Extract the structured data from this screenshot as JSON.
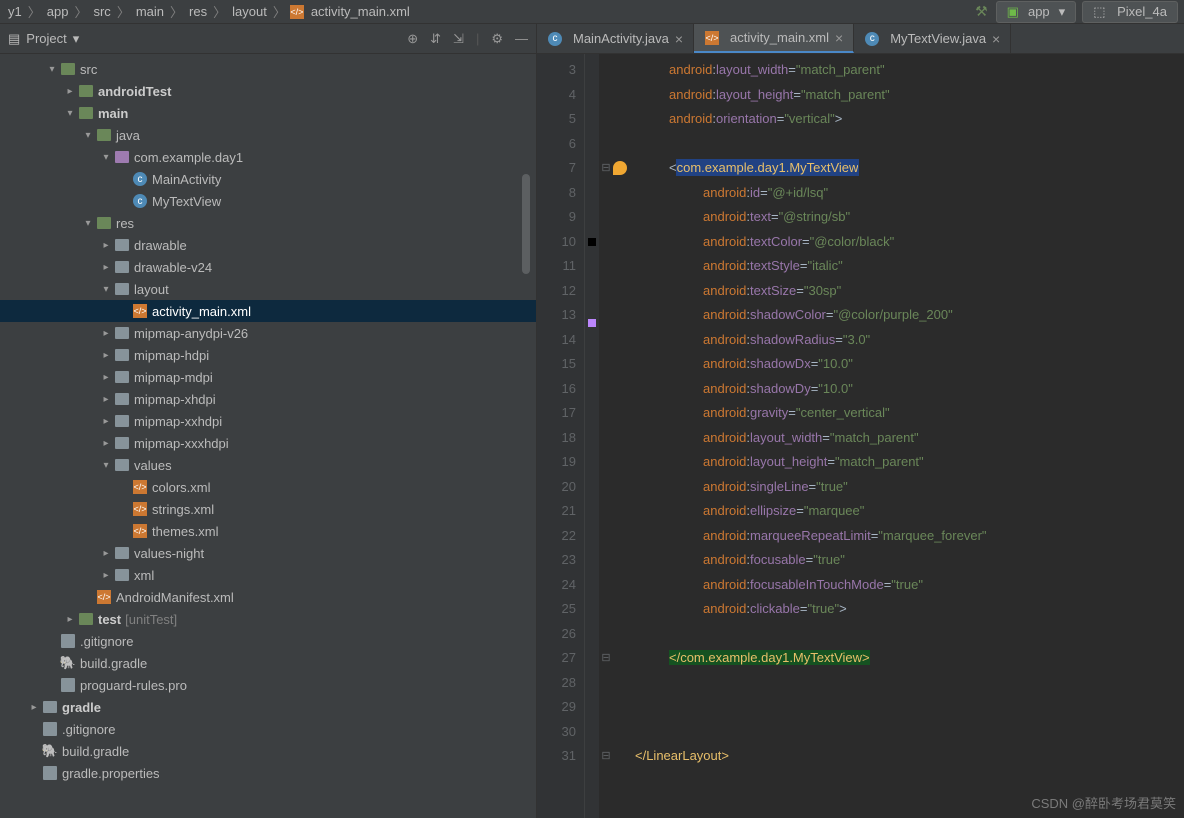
{
  "breadcrumb": {
    "project": "y1",
    "items": [
      "app",
      "src",
      "main",
      "res",
      "layout",
      "activity_main.xml"
    ]
  },
  "runconfig": {
    "label": "app",
    "device": "Pixel_4a"
  },
  "sidebar": {
    "title": "Project",
    "tree": [
      {
        "indent": 2,
        "arrow": "▾",
        "icon": "folder-src",
        "label": "src",
        "bold": false
      },
      {
        "indent": 3,
        "arrow": "▸",
        "icon": "folder-src",
        "label": "androidTest",
        "bold": true
      },
      {
        "indent": 3,
        "arrow": "▾",
        "icon": "folder-src",
        "label": "main",
        "bold": true
      },
      {
        "indent": 4,
        "arrow": "▾",
        "icon": "folder-src",
        "label": "java",
        "bold": false
      },
      {
        "indent": 5,
        "arrow": "▾",
        "icon": "pkg",
        "label": "com.example.day1",
        "bold": false
      },
      {
        "indent": 6,
        "arrow": "",
        "icon": "class",
        "label": "MainActivity",
        "bold": false
      },
      {
        "indent": 6,
        "arrow": "",
        "icon": "class",
        "label": "MyTextView",
        "bold": false
      },
      {
        "indent": 4,
        "arrow": "▾",
        "icon": "folder-src",
        "label": "res",
        "bold": false
      },
      {
        "indent": 5,
        "arrow": "▸",
        "icon": "folder",
        "label": "drawable",
        "bold": false
      },
      {
        "indent": 5,
        "arrow": "▸",
        "icon": "folder",
        "label": "drawable-v24",
        "bold": false
      },
      {
        "indent": 5,
        "arrow": "▾",
        "icon": "folder",
        "label": "layout",
        "bold": false
      },
      {
        "indent": 6,
        "arrow": "",
        "icon": "xml",
        "label": "activity_main.xml",
        "bold": false,
        "selected": true
      },
      {
        "indent": 5,
        "arrow": "▸",
        "icon": "folder",
        "label": "mipmap-anydpi-v26",
        "bold": false
      },
      {
        "indent": 5,
        "arrow": "▸",
        "icon": "folder",
        "label": "mipmap-hdpi",
        "bold": false
      },
      {
        "indent": 5,
        "arrow": "▸",
        "icon": "folder",
        "label": "mipmap-mdpi",
        "bold": false
      },
      {
        "indent": 5,
        "arrow": "▸",
        "icon": "folder",
        "label": "mipmap-xhdpi",
        "bold": false
      },
      {
        "indent": 5,
        "arrow": "▸",
        "icon": "folder",
        "label": "mipmap-xxhdpi",
        "bold": false
      },
      {
        "indent": 5,
        "arrow": "▸",
        "icon": "folder",
        "label": "mipmap-xxxhdpi",
        "bold": false
      },
      {
        "indent": 5,
        "arrow": "▾",
        "icon": "folder",
        "label": "values",
        "bold": false
      },
      {
        "indent": 6,
        "arrow": "",
        "icon": "xml",
        "label": "colors.xml",
        "bold": false
      },
      {
        "indent": 6,
        "arrow": "",
        "icon": "xml",
        "label": "strings.xml",
        "bold": false
      },
      {
        "indent": 6,
        "arrow": "",
        "icon": "xml",
        "label": "themes.xml",
        "bold": false
      },
      {
        "indent": 5,
        "arrow": "▸",
        "icon": "folder",
        "label": "values-night",
        "bold": false
      },
      {
        "indent": 5,
        "arrow": "▸",
        "icon": "folder",
        "label": "xml",
        "bold": false
      },
      {
        "indent": 4,
        "arrow": "",
        "icon": "xml",
        "label": "AndroidManifest.xml",
        "bold": false
      },
      {
        "indent": 3,
        "arrow": "▸",
        "icon": "folder-test",
        "label": "test",
        "hint": "[unitTest]",
        "bold": true
      },
      {
        "indent": 2,
        "arrow": "",
        "icon": "file",
        "label": ".gitignore",
        "bold": false
      },
      {
        "indent": 2,
        "arrow": "",
        "icon": "gradle",
        "label": "build.gradle",
        "bold": false
      },
      {
        "indent": 2,
        "arrow": "",
        "icon": "file",
        "label": "proguard-rules.pro",
        "bold": false
      },
      {
        "indent": 1,
        "arrow": "▸",
        "icon": "folder",
        "label": "gradle",
        "bold": true
      },
      {
        "indent": 1,
        "arrow": "",
        "icon": "file",
        "label": ".gitignore",
        "bold": false
      },
      {
        "indent": 1,
        "arrow": "",
        "icon": "gradle",
        "label": "build.gradle",
        "bold": false
      },
      {
        "indent": 1,
        "arrow": "",
        "icon": "file",
        "label": "gradle.properties",
        "bold": false
      }
    ]
  },
  "tabs": [
    {
      "icon": "class",
      "label": "MainActivity.java",
      "active": false
    },
    {
      "icon": "xml",
      "label": "activity_main.xml",
      "active": true
    },
    {
      "icon": "class",
      "label": "MyTextView.java",
      "active": false
    }
  ],
  "code": {
    "start": 3,
    "lines": [
      {
        "n": 3,
        "tokens": [
          [
            "i",
            4
          ],
          [
            "ns",
            "android"
          ],
          [
            "op",
            ":"
          ],
          [
            "attr",
            "layout_width"
          ],
          [
            "op",
            "="
          ],
          [
            "str",
            "\"match_parent\""
          ]
        ]
      },
      {
        "n": 4,
        "tokens": [
          [
            "i",
            4
          ],
          [
            "ns",
            "android"
          ],
          [
            "op",
            ":"
          ],
          [
            "attr",
            "layout_height"
          ],
          [
            "op",
            "="
          ],
          [
            "str",
            "\"match_parent\""
          ]
        ]
      },
      {
        "n": 5,
        "tokens": [
          [
            "i",
            4
          ],
          [
            "ns",
            "android"
          ],
          [
            "op",
            ":"
          ],
          [
            "attr",
            "orientation"
          ],
          [
            "op",
            "="
          ],
          [
            "str",
            "\"vertical\""
          ],
          [
            "op",
            ">"
          ]
        ]
      },
      {
        "n": 6,
        "tokens": []
      },
      {
        "n": 7,
        "bulb": true,
        "fold": "⊟",
        "tokens": [
          [
            "i",
            4
          ],
          [
            "op",
            "<"
          ],
          [
            "tagc",
            "com.example.day1.MyTextView"
          ]
        ]
      },
      {
        "n": 8,
        "tokens": [
          [
            "i",
            8
          ],
          [
            "ns",
            "android"
          ],
          [
            "op",
            ":"
          ],
          [
            "attr",
            "id"
          ],
          [
            "op",
            "="
          ],
          [
            "str",
            "\"@+id/lsq\""
          ]
        ]
      },
      {
        "n": 9,
        "tokens": [
          [
            "i",
            8
          ],
          [
            "ns",
            "android"
          ],
          [
            "op",
            ":"
          ],
          [
            "attr",
            "text"
          ],
          [
            "op",
            "="
          ],
          [
            "str",
            "\"@string/sb\""
          ]
        ]
      },
      {
        "n": 10,
        "marker": "#000",
        "tokens": [
          [
            "i",
            8
          ],
          [
            "ns",
            "android"
          ],
          [
            "op",
            ":"
          ],
          [
            "attr",
            "textColor"
          ],
          [
            "op",
            "="
          ],
          [
            "str",
            "\"@color/black\""
          ]
        ]
      },
      {
        "n": 11,
        "tokens": [
          [
            "i",
            8
          ],
          [
            "ns",
            "android"
          ],
          [
            "op",
            ":"
          ],
          [
            "attr",
            "textStyle"
          ],
          [
            "op",
            "="
          ],
          [
            "str",
            "\"italic\""
          ]
        ]
      },
      {
        "n": 12,
        "tokens": [
          [
            "i",
            8
          ],
          [
            "ns",
            "android"
          ],
          [
            "op",
            ":"
          ],
          [
            "attr",
            "textSize"
          ],
          [
            "op",
            "="
          ],
          [
            "str",
            "\"30sp\""
          ]
        ]
      },
      {
        "n": 13,
        "marker": "#bb86fc",
        "tokens": [
          [
            "i",
            8
          ],
          [
            "ns",
            "android"
          ],
          [
            "op",
            ":"
          ],
          [
            "attr",
            "shadowColor"
          ],
          [
            "op",
            "="
          ],
          [
            "str",
            "\"@color/purple_200\""
          ]
        ]
      },
      {
        "n": 14,
        "tokens": [
          [
            "i",
            8
          ],
          [
            "ns",
            "android"
          ],
          [
            "op",
            ":"
          ],
          [
            "attr",
            "shadowRadius"
          ],
          [
            "op",
            "="
          ],
          [
            "str",
            "\"3.0\""
          ]
        ]
      },
      {
        "n": 15,
        "tokens": [
          [
            "i",
            8
          ],
          [
            "ns",
            "android"
          ],
          [
            "op",
            ":"
          ],
          [
            "attr",
            "shadowDx"
          ],
          [
            "op",
            "="
          ],
          [
            "str",
            "\"10.0\""
          ]
        ]
      },
      {
        "n": 16,
        "tokens": [
          [
            "i",
            8
          ],
          [
            "ns",
            "android"
          ],
          [
            "op",
            ":"
          ],
          [
            "attr",
            "shadowDy"
          ],
          [
            "op",
            "="
          ],
          [
            "str",
            "\"10.0\""
          ]
        ]
      },
      {
        "n": 17,
        "tokens": [
          [
            "i",
            8
          ],
          [
            "ns",
            "android"
          ],
          [
            "op",
            ":"
          ],
          [
            "attr",
            "gravity"
          ],
          [
            "op",
            "="
          ],
          [
            "str",
            "\"center_vertical\""
          ]
        ]
      },
      {
        "n": 18,
        "tokens": [
          [
            "i",
            8
          ],
          [
            "ns",
            "android"
          ],
          [
            "op",
            ":"
          ],
          [
            "attr",
            "layout_width"
          ],
          [
            "op",
            "="
          ],
          [
            "str",
            "\"match_parent\""
          ]
        ]
      },
      {
        "n": 19,
        "tokens": [
          [
            "i",
            8
          ],
          [
            "ns",
            "android"
          ],
          [
            "op",
            ":"
          ],
          [
            "attr",
            "layout_height"
          ],
          [
            "op",
            "="
          ],
          [
            "str",
            "\"match_parent\""
          ]
        ]
      },
      {
        "n": 20,
        "tokens": [
          [
            "i",
            8
          ],
          [
            "ns",
            "android"
          ],
          [
            "op",
            ":"
          ],
          [
            "attr",
            "singleLine"
          ],
          [
            "op",
            "="
          ],
          [
            "str",
            "\"true\""
          ]
        ]
      },
      {
        "n": 21,
        "tokens": [
          [
            "i",
            8
          ],
          [
            "ns",
            "android"
          ],
          [
            "op",
            ":"
          ],
          [
            "attr",
            "ellipsize"
          ],
          [
            "op",
            "="
          ],
          [
            "str",
            "\"marquee\""
          ]
        ]
      },
      {
        "n": 22,
        "tokens": [
          [
            "i",
            8
          ],
          [
            "ns",
            "android"
          ],
          [
            "op",
            ":"
          ],
          [
            "attr",
            "marqueeRepeatLimit"
          ],
          [
            "op",
            "="
          ],
          [
            "str",
            "\"marquee_forever\""
          ]
        ]
      },
      {
        "n": 23,
        "tokens": [
          [
            "i",
            8
          ],
          [
            "ns",
            "android"
          ],
          [
            "op",
            ":"
          ],
          [
            "attr",
            "focusable"
          ],
          [
            "op",
            "="
          ],
          [
            "str",
            "\"true\""
          ]
        ]
      },
      {
        "n": 24,
        "tokens": [
          [
            "i",
            8
          ],
          [
            "ns",
            "android"
          ],
          [
            "op",
            ":"
          ],
          [
            "attr",
            "focusableInTouchMode"
          ],
          [
            "op",
            "="
          ],
          [
            "str",
            "\"true\""
          ]
        ]
      },
      {
        "n": 25,
        "tokens": [
          [
            "i",
            8
          ],
          [
            "ns",
            "android"
          ],
          [
            "op",
            ":"
          ],
          [
            "attr",
            "clickable"
          ],
          [
            "op",
            "="
          ],
          [
            "str",
            "\"true\""
          ],
          [
            "op",
            ">"
          ]
        ]
      },
      {
        "n": 26,
        "tokens": []
      },
      {
        "n": 27,
        "fold": "⊟",
        "tokens": [
          [
            "i",
            4
          ],
          [
            "hl",
            "</com.example.day1.MyTextView>"
          ]
        ]
      },
      {
        "n": 28,
        "tokens": []
      },
      {
        "n": 29,
        "tokens": []
      },
      {
        "n": 30,
        "tokens": []
      },
      {
        "n": 31,
        "fold": "⊟",
        "tokens": [
          [
            "tag",
            "</LinearLayout>"
          ]
        ]
      }
    ]
  },
  "watermark": "CSDN @醉卧考场君莫笑"
}
